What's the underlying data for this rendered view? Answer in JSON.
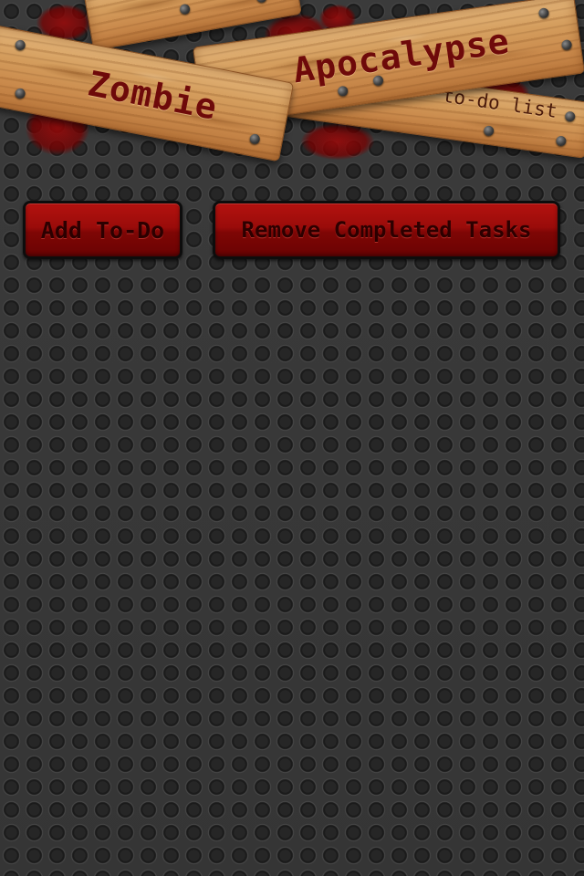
{
  "header": {
    "title_word_1": "Zombie",
    "title_word_2": "Apocalypse",
    "subtitle": "to-do list"
  },
  "toolbar": {
    "add_label": "Add To-Do",
    "remove_label": "Remove Completed Tasks"
  },
  "colors": {
    "button_red": "#9a0c0a",
    "wood": "#d49d5d",
    "background": "#3a3a3a",
    "title_text": "#6e0a0a"
  },
  "icons": [
    "nail-icon"
  ]
}
